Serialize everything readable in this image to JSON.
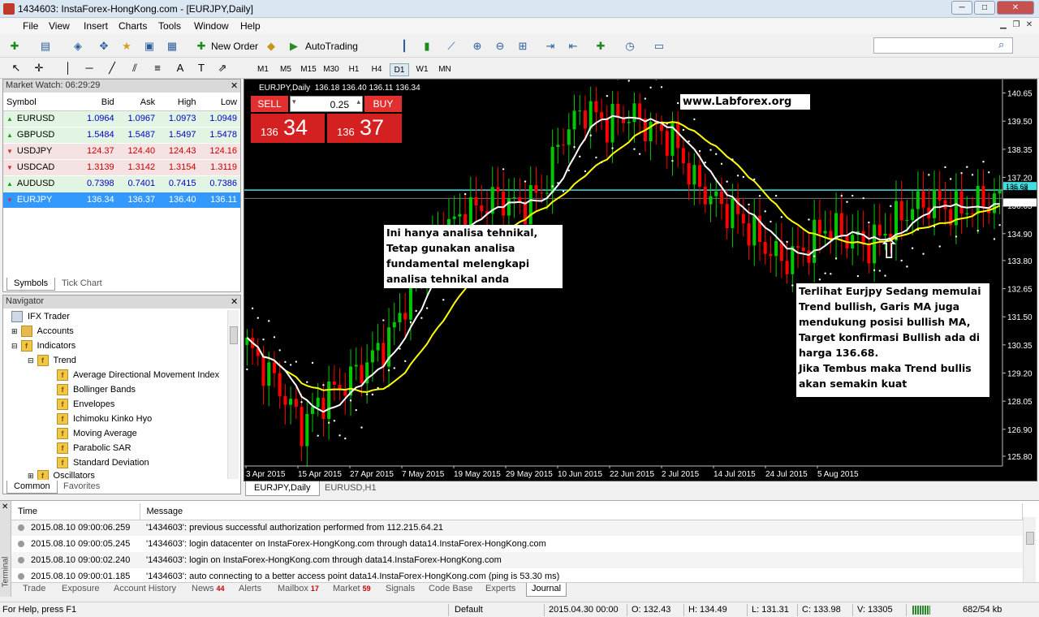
{
  "window": {
    "title": "1434603: InstaForex-HongKong.com - [EURJPY,Daily]",
    "min": "─",
    "max": "□",
    "close": "✕"
  },
  "menu": [
    "File",
    "View",
    "Insert",
    "Charts",
    "Tools",
    "Window",
    "Help"
  ],
  "toolbar": {
    "new_order": "New Order",
    "autotrading": "AutoTrading"
  },
  "timeframes": [
    "M1",
    "M5",
    "M15",
    "M30",
    "H1",
    "H4",
    "D1",
    "W1",
    "MN"
  ],
  "active_timeframe": "D1",
  "market_watch": {
    "title": "Market Watch: 06:29:29",
    "columns": [
      "Symbol",
      "Bid",
      "Ask",
      "High",
      "Low"
    ],
    "rows": [
      {
        "symbol": "EURUSD",
        "bid": "1.0964",
        "ask": "1.0967",
        "high": "1.0973",
        "low": "1.0949",
        "dir": "up"
      },
      {
        "symbol": "GBPUSD",
        "bid": "1.5484",
        "ask": "1.5487",
        "high": "1.5497",
        "low": "1.5478",
        "dir": "up"
      },
      {
        "symbol": "USDJPY",
        "bid": "124.37",
        "ask": "124.40",
        "high": "124.43",
        "low": "124.16",
        "dir": "down"
      },
      {
        "symbol": "USDCAD",
        "bid": "1.3139",
        "ask": "1.3142",
        "high": "1.3154",
        "low": "1.3119",
        "dir": "down"
      },
      {
        "symbol": "AUDUSD",
        "bid": "0.7398",
        "ask": "0.7401",
        "high": "0.7415",
        "low": "0.7386",
        "dir": "up"
      },
      {
        "symbol": "EURJPY",
        "bid": "136.34",
        "ask": "136.37",
        "high": "136.40",
        "low": "136.11",
        "dir": "down",
        "selected": true
      }
    ],
    "tabs": [
      "Symbols",
      "Tick Chart"
    ]
  },
  "navigator": {
    "title": "Navigator",
    "root": "IFX Trader",
    "accounts": "Accounts",
    "indicators": "Indicators",
    "trend": "Trend",
    "items": [
      "Average Directional Movement Index",
      "Bollinger Bands",
      "Envelopes",
      "Ichimoku Kinko Hyo",
      "Moving Average",
      "Parabolic SAR",
      "Standard Deviation"
    ],
    "oscillators": "Oscillators",
    "tabs": [
      "Common",
      "Favorites"
    ]
  },
  "chart": {
    "header": "EURJPY,Daily  136.18 136.40 136.11 136.34",
    "sell_label": "SELL",
    "buy_label": "BUY",
    "volume": "0.25",
    "sell_big": "34",
    "sell_small": "136",
    "buy_big": "37",
    "buy_small": "136",
    "watermark": "www.Labforex.org",
    "note1": [
      "Ini hanya analisa tehnikal,",
      "Tetap gunakan analisa",
      "fundamental melengkapi",
      "analisa tehnikal anda"
    ],
    "note2": [
      "Terlihat Eurjpy Sedang memulai",
      "Trend bullish, Garis MA juga",
      "mendukung posisi bullish MA,",
      "Target konfirmasi Bullish ada di",
      "harga 136.68.",
      "Jika Tembus maka Trend bullis",
      "akan semakin kuat"
    ],
    "arrow": "⇧",
    "price_labels": [
      "140.65",
      "139.50",
      "138.35",
      "137.20",
      "136.05",
      "134.90",
      "133.80",
      "132.65",
      "131.50",
      "130.35",
      "129.20",
      "128.05",
      "126.90",
      "125.80"
    ],
    "level_labels": [
      "136.68",
      "136.34"
    ],
    "date_labels": [
      "3 Apr 2015",
      "15 Apr 2015",
      "27 Apr 2015",
      "7 May 2015",
      "19 May 2015",
      "29 May 2015",
      "10 Jun 2015",
      "22 Jun 2015",
      "2 Jul 2015",
      "14 Jul 2015",
      "24 Jul 2015",
      "5 Aug 2015"
    ],
    "colors": {
      "bull": "#00c800",
      "bear": "#ff0000",
      "ma_fast": "#ffffff",
      "ma_slow": "#ffff00",
      "level": "#40e0e0",
      "sar": "#ffffff"
    },
    "tabs": [
      "EURJPY,Daily",
      "EURUSD,H1"
    ]
  },
  "terminal": {
    "side_label": "Terminal",
    "columns": [
      "Time",
      "Message"
    ],
    "rows": [
      {
        "time": "2015.08.10 09:00:06.259",
        "message": "'1434603': previous successful authorization performed from 112.215.64.21"
      },
      {
        "time": "2015.08.10 09:00:05.245",
        "message": "'1434603': login datacenter on InstaForex-HongKong.com through data14.InstaForex-HongKong.com"
      },
      {
        "time": "2015.08.10 09:00:02.240",
        "message": "'1434603': login on InstaForex-HongKong.com through data14.InstaForex-HongKong.com"
      },
      {
        "time": "2015.08.10 09:00:01.185",
        "message": "'1434603': auto connecting to a better access point data14.InstaForex-HongKong.com (ping is 53.30 ms)"
      }
    ],
    "tabs": [
      {
        "label": "Trade"
      },
      {
        "label": "Exposure"
      },
      {
        "label": "Account History"
      },
      {
        "label": "News",
        "badge": "44"
      },
      {
        "label": "Alerts"
      },
      {
        "label": "Mailbox",
        "badge": "17"
      },
      {
        "label": "Market",
        "badge": "59"
      },
      {
        "label": "Signals"
      },
      {
        "label": "Code Base"
      },
      {
        "label": "Experts"
      },
      {
        "label": "Journal",
        "active": true
      }
    ]
  },
  "status": {
    "help": "For Help, press F1",
    "profile": "Default",
    "datetime": "2015.04.30 00:00",
    "open": "O: 132.43",
    "high": "H: 134.49",
    "low": "L: 131.31",
    "close": "C: 133.98",
    "volume": "V: 13305",
    "traffic": "682/54 kb"
  }
}
